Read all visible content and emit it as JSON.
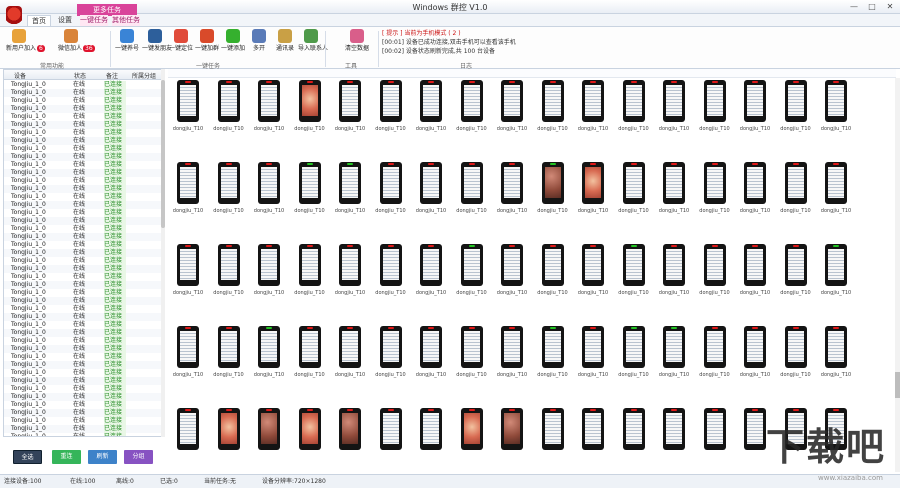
{
  "window": {
    "title": "Windows 群控 V1.0",
    "min": "—",
    "max": "□",
    "close": "✕"
  },
  "tabs": {
    "group_label": "更多任务",
    "items": [
      "首页",
      "设置",
      "一键任务",
      "其他任务"
    ]
  },
  "ribbon": {
    "buttons": [
      {
        "label": "新用户加入",
        "badge": "6"
      },
      {
        "label": "微信加人",
        "badge": "36"
      },
      {
        "label": "一键养号",
        "badge": ""
      },
      {
        "label": "一键发朋友",
        "badge": ""
      },
      {
        "label": "一键定位",
        "badge": ""
      },
      {
        "label": "一键加群",
        "badge": ""
      },
      {
        "label": "一键添加",
        "badge": ""
      },
      {
        "label": "多开",
        "badge": ""
      },
      {
        "label": "通讯录",
        "badge": ""
      },
      {
        "label": "导入联系人",
        "badge": ""
      },
      {
        "label": "清空数据",
        "badge": ""
      }
    ],
    "group_labels": [
      "常用功能",
      "一键任务",
      "工具",
      "日志"
    ],
    "log": [
      "[ 提示 ] 当前为手机模式 ( 2 )",
      "[00:01] 设备已成功连接,双击手机可以查看该手机",
      "[00:02] 设备状态刷新完成,共 100 台设备"
    ]
  },
  "table": {
    "headers": [
      "设备",
      "状态",
      "备注",
      "所属分组"
    ],
    "rows": [
      [
        "TongJiu_1_0",
        "在线",
        "已连接"
      ],
      [
        "TongJiu_1_0",
        "在线",
        "已连接"
      ],
      [
        "TongJiu_1_0",
        "在线",
        "已连接"
      ],
      [
        "TongJiu_1_0",
        "在线",
        "已连接"
      ],
      [
        "TongJiu_1_0",
        "在线",
        "已连接"
      ],
      [
        "TongJiu_1_0",
        "在线",
        "已连接"
      ],
      [
        "TongJiu_1_0",
        "在线",
        "已连接"
      ],
      [
        "TongJiu_1_0",
        "在线",
        "已连接"
      ],
      [
        "TongJiu_1_0",
        "在线",
        "已连接"
      ],
      [
        "TongJiu_1_0",
        "在线",
        "已连接"
      ],
      [
        "TongJiu_1_0",
        "在线",
        "已连接"
      ],
      [
        "TongJiu_1_0",
        "在线",
        "已连接"
      ],
      [
        "TongJiu_1_0",
        "在线",
        "已连接"
      ],
      [
        "TongJiu_1_0",
        "在线",
        "已连接"
      ],
      [
        "TongJiu_1_0",
        "在线",
        "已连接"
      ],
      [
        "TongJiu_1_0",
        "在线",
        "已连接"
      ],
      [
        "TongJiu_1_0",
        "在线",
        "已连接"
      ],
      [
        "TongJiu_1_0",
        "在线",
        "已连接"
      ],
      [
        "TongJiu_1_0",
        "在线",
        "已连接"
      ],
      [
        "TongJiu_1_0",
        "在线",
        "已连接"
      ],
      [
        "TongJiu_1_0",
        "在线",
        "已连接"
      ],
      [
        "TongJiu_1_0",
        "在线",
        "已连接"
      ],
      [
        "TongJiu_1_0",
        "在线",
        "已连接"
      ],
      [
        "TongJiu_1_0",
        "在线",
        "已连接"
      ],
      [
        "TongJiu_1_0",
        "在线",
        "已连接"
      ],
      [
        "TongJiu_1_0",
        "在线",
        "已连接"
      ],
      [
        "TongJiu_1_0",
        "在线",
        "已连接"
      ],
      [
        "TongJiu_1_0",
        "在线",
        "已连接"
      ],
      [
        "TongJiu_1_0",
        "在线",
        "已连接"
      ],
      [
        "TongJiu_1_0",
        "在线",
        "已连接"
      ],
      [
        "TongJiu_1_0",
        "在线",
        "已连接"
      ],
      [
        "TongJiu_1_0",
        "在线",
        "已连接"
      ],
      [
        "TongJiu_1_0",
        "在线",
        "已连接"
      ],
      [
        "TongJiu_1_0",
        "在线",
        "已连接"
      ],
      [
        "TongJiu_1_0",
        "在线",
        "已连接"
      ],
      [
        "TongJiu_1_0",
        "在线",
        "已连接"
      ],
      [
        "TongJiu_1_0",
        "在线",
        "已连接"
      ],
      [
        "TongJiu_1_0",
        "在线",
        "已连接"
      ],
      [
        "TongJiu_1_0",
        "在线",
        "已连接"
      ],
      [
        "TongJiu_1_0",
        "在线",
        "已连接"
      ],
      [
        "TongJiu_1_0",
        "在线",
        "已连接"
      ],
      [
        "TongJiu_1_0",
        "在线",
        "已连接"
      ],
      [
        "TongJiu_1_0",
        "在线",
        "已连接"
      ],
      [
        "TongJiu_1_0",
        "在线",
        "已连接"
      ],
      [
        "TongJiu_1_0",
        "在线",
        "已连接"
      ]
    ],
    "bottom_buttons": [
      "全选",
      "重连",
      "刷新",
      "分组"
    ]
  },
  "grid": {
    "caption": "dongjiu_T10",
    "rows": 5,
    "cols": 17,
    "photo_cells": [
      3,
      26,
      27,
      69,
      70,
      71,
      72,
      75,
      76
    ],
    "green_leds": [
      20,
      21,
      26,
      41,
      45,
      50,
      53,
      60,
      62,
      63
    ]
  },
  "statusbar": {
    "items": [
      "连接设备:100",
      "在线:100",
      "离线:0",
      "已选:0",
      "当前任务:无",
      "设备分辨率:720×1280"
    ]
  },
  "watermark": {
    "text": "下载吧",
    "url": "www.xiazaiba.com"
  }
}
